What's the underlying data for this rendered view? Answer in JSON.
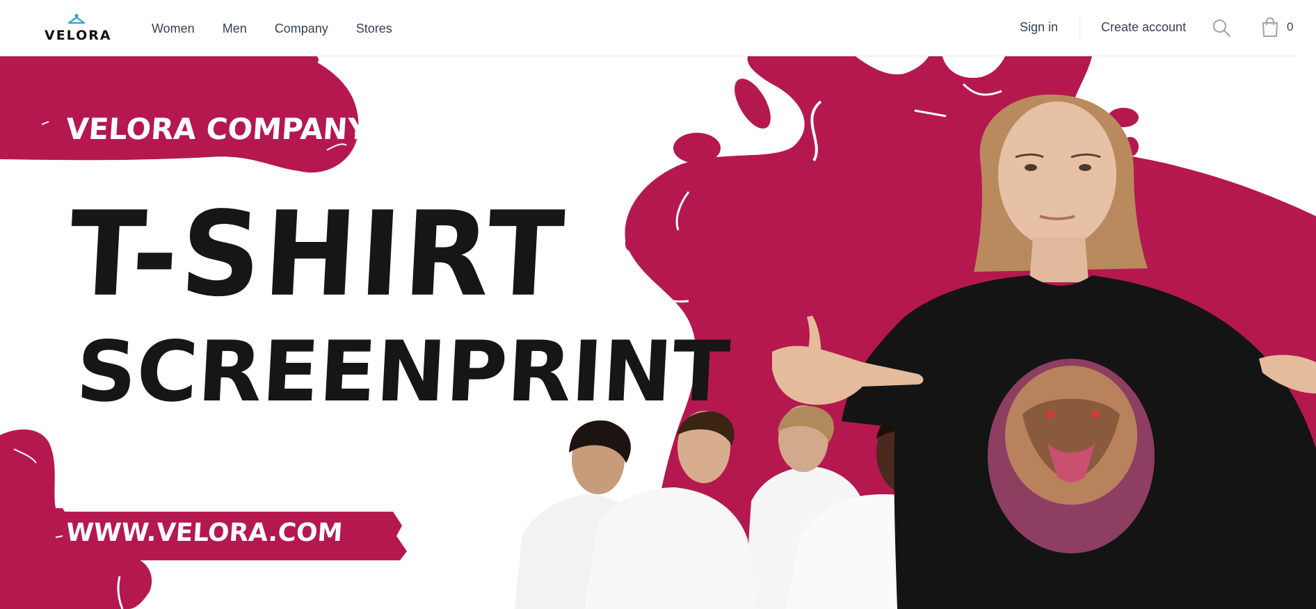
{
  "header": {
    "logo_text": "VELORA",
    "nav": [
      {
        "label": "Women"
      },
      {
        "label": "Men"
      },
      {
        "label": "Company"
      },
      {
        "label": "Stores"
      }
    ],
    "sign_in": "Sign in",
    "create_account": "Create account",
    "cart_count": "0",
    "icons": {
      "search": "search-icon",
      "cart": "shopping-bag-icon",
      "logo": "hanger-icon"
    }
  },
  "hero": {
    "company_label": "VELORA COMPANY",
    "title_line_1": "T-SHIRT",
    "title_line_2": "SCREENPRINT",
    "url": "WWW.VELORA.COM",
    "colors": {
      "accent": "#b5184f",
      "ink": "#161616",
      "background": "#ffffff"
    }
  }
}
